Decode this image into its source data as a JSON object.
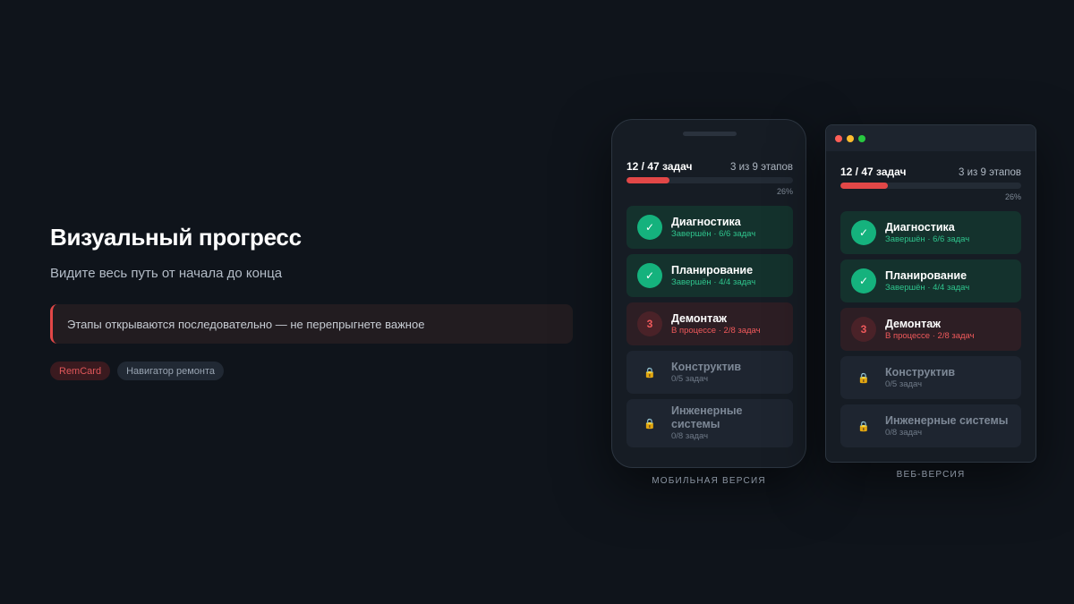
{
  "hero": {
    "title": "Визуальный прогресс",
    "subtitle": "Видите весь путь от начала до конца",
    "callout": "Этапы открываются последовательно — не перепрыгнете важное",
    "tags": [
      "RemCard",
      "Навигатор ремонта"
    ]
  },
  "progress": {
    "count_label": "12 / 47 задач",
    "stages_label": "3 из 9 этапов",
    "percent_label": "26%",
    "fraction": 0.26
  },
  "stages": [
    {
      "title": "Диагностика",
      "meta": "Завершён · 6/6 задач",
      "status": "done",
      "badge": "✓"
    },
    {
      "title": "Планирование",
      "meta": "Завершён · 4/4 задач",
      "status": "done",
      "badge": "✓"
    },
    {
      "title": "Демонтаж",
      "meta": "В процессе · 2/8 задач",
      "status": "active",
      "badge": "3"
    },
    {
      "title": "Конструктив",
      "meta": "0/5 задач",
      "status": "locked",
      "badge": "🔒"
    },
    {
      "title": "Инженерные системы",
      "meta": "0/8 задач",
      "status": "locked",
      "badge": "🔒"
    }
  ],
  "labels": {
    "mobile": "МОБИЛЬНАЯ ВЕРСИЯ",
    "web": "ВЕБ-ВЕРСИЯ"
  },
  "colors": {
    "accent": "#e24747",
    "success": "#15b27d",
    "background": "#0f141b"
  }
}
